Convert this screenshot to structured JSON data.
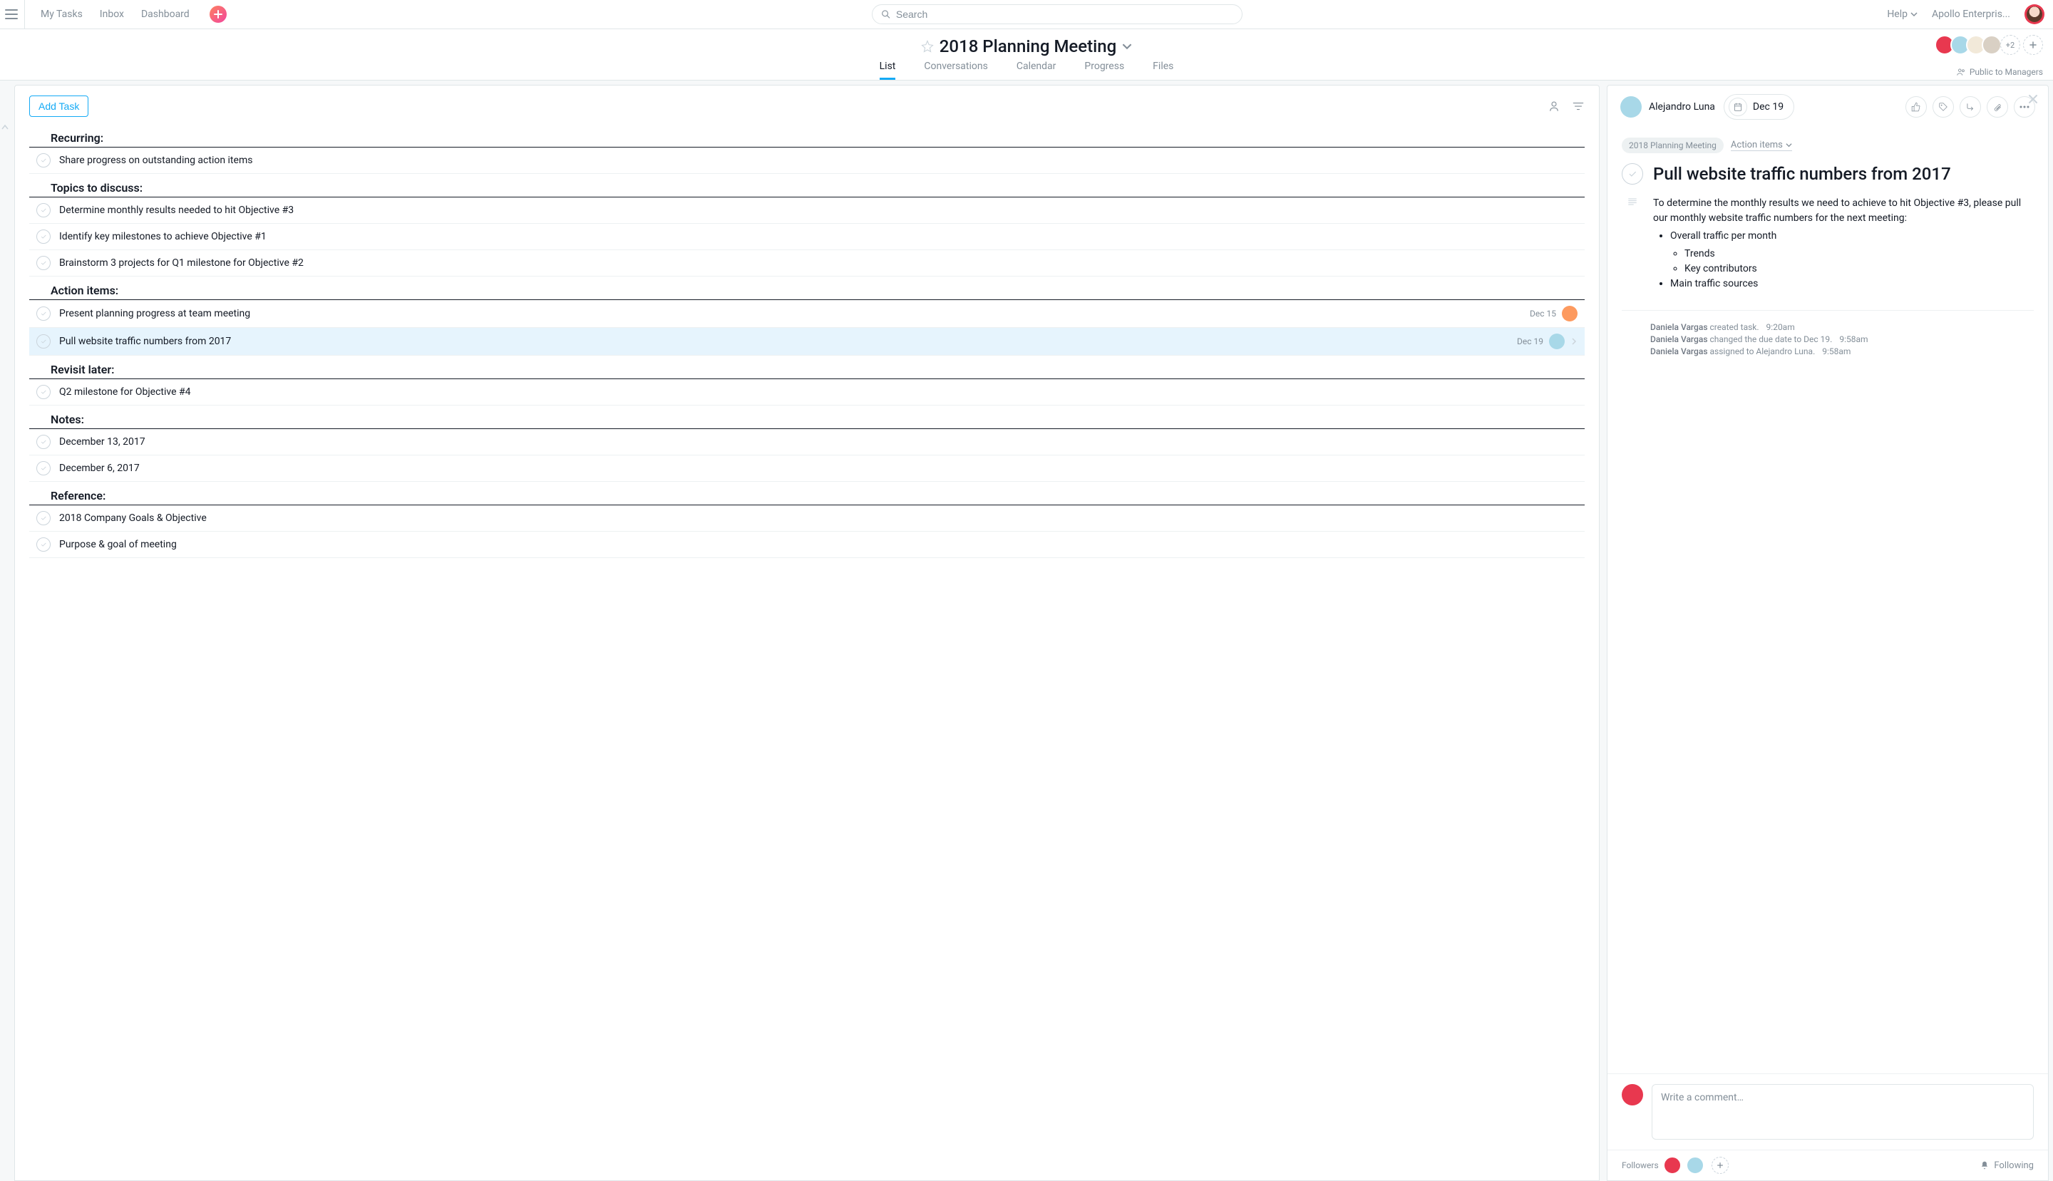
{
  "topbar": {
    "my_tasks": "My Tasks",
    "inbox": "Inbox",
    "dashboard": "Dashboard",
    "search_placeholder": "Search",
    "help": "Help",
    "workspace": "Apollo Enterpris..."
  },
  "project": {
    "title": "2018 Planning Meeting",
    "tabs": {
      "list": "List",
      "conversations": "Conversations",
      "calendar": "Calendar",
      "progress": "Progress",
      "files": "Files"
    },
    "members_more": "+2",
    "visibility": "Public to Managers"
  },
  "list": {
    "add_task": "Add Task",
    "sections": [
      {
        "name": "Recurring:",
        "tasks": [
          {
            "title": "Share progress on outstanding action items"
          }
        ]
      },
      {
        "name": "Topics to discuss:",
        "tasks": [
          {
            "title": "Determine monthly results needed to hit Objective #3"
          },
          {
            "title": "Identify key milestones to achieve Objective #1"
          },
          {
            "title": "Brainstorm 3 projects for Q1 milestone for Objective #2"
          }
        ]
      },
      {
        "name": "Action items:",
        "tasks": [
          {
            "title": "Present planning progress at team meeting",
            "date": "Dec 15",
            "avatar": "orange"
          },
          {
            "title": "Pull website traffic numbers from 2017",
            "date": "Dec 19",
            "avatar": "blue",
            "selected": true,
            "chevron": true
          }
        ]
      },
      {
        "name": "Revisit later:",
        "tasks": [
          {
            "title": "Q2 milestone for Objective #4"
          }
        ]
      },
      {
        "name": "Notes:",
        "tasks": [
          {
            "title": "December 13, 2017"
          },
          {
            "title": "December 6, 2017"
          }
        ]
      },
      {
        "name": "Reference:",
        "tasks": [
          {
            "title": "2018 Company Goals & Objective"
          },
          {
            "title": "Purpose & goal of meeting"
          }
        ]
      }
    ]
  },
  "detail": {
    "assignee": "Alejandro Luna",
    "due": "Dec 19",
    "crumb_project": "2018 Planning Meeting",
    "crumb_section": "Action items",
    "title": "Pull website traffic numbers from 2017",
    "description_intro": "To determine the monthly results we need to achieve to hit Objective #3, please pull our monthly website traffic numbers for the next meeting:",
    "bullets": {
      "b1": "Overall traffic per month",
      "b1a": "Trends",
      "b1b": "Key contributors",
      "b2": "Main traffic sources"
    },
    "activity": [
      {
        "who": "Daniela Vargas",
        "what": "created task.",
        "when": "9:20am"
      },
      {
        "who": "Daniela Vargas",
        "what": "changed the due date to Dec 19.",
        "when": "9:58am"
      },
      {
        "who": "Daniela Vargas",
        "what": "assigned to Alejandro Luna.",
        "when": "9:58am"
      }
    ],
    "comment_placeholder": "Write a comment…",
    "followers_label": "Followers",
    "following": "Following"
  }
}
